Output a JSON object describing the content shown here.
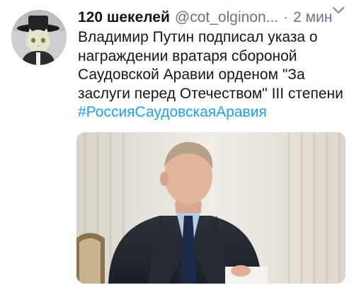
{
  "tweet": {
    "display_name": "120 шекелей",
    "handle": "@cot_olginon...",
    "separator": "·",
    "time": "2 мин",
    "text_lines": [
      "Владимир Путин подписал указа о",
      "награждении вратаря сбороной",
      "Саудовской Аравии орденом \"За",
      "заслуги перед Отечеством\" III степени"
    ],
    "hashtag": "#РоссияСаудовскаяАравия"
  },
  "icons": {
    "avatar": "avatar-cat-icon",
    "menu": "chevron-down-icon"
  },
  "colors": {
    "text": "#14171a",
    "secondary": "#657786",
    "link": "#1da1f2"
  }
}
